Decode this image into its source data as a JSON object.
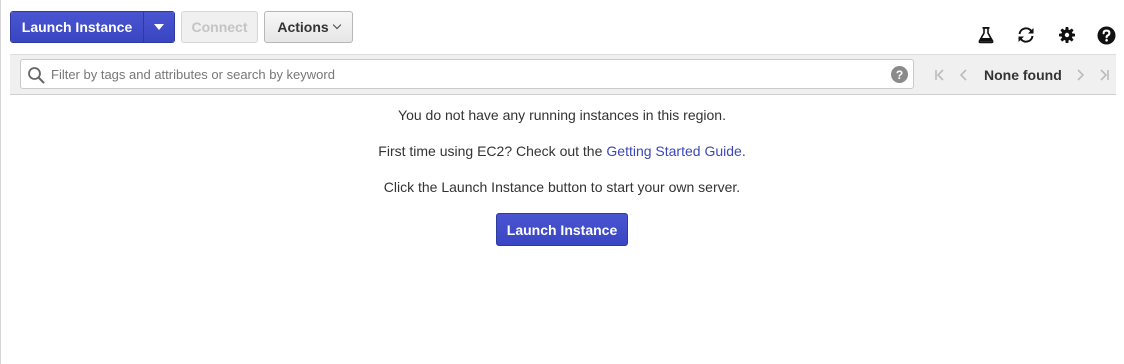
{
  "toolbar": {
    "launch_label": "Launch Instance",
    "connect_label": "Connect",
    "actions_label": "Actions"
  },
  "tool_icons": [
    "flask-icon",
    "refresh-icon",
    "gear-icon",
    "help-icon"
  ],
  "filter": {
    "placeholder": "Filter by tags and attributes or search by keyword",
    "help_glyph": "?",
    "pager_label": "None found"
  },
  "empty_state": {
    "line1": "You do not have any running instances in this region.",
    "line2_prefix": "First time using EC2? Check out the",
    "line2_link": "Getting Started Guide",
    "line2_suffix": ".",
    "line3": "Click the Launch Instance button to start your own server.",
    "button_label": "Launch Instance"
  },
  "colors": {
    "primary": "#3a45c3",
    "link": "#3b47b8",
    "filter_bg": "#f0f0f0"
  }
}
